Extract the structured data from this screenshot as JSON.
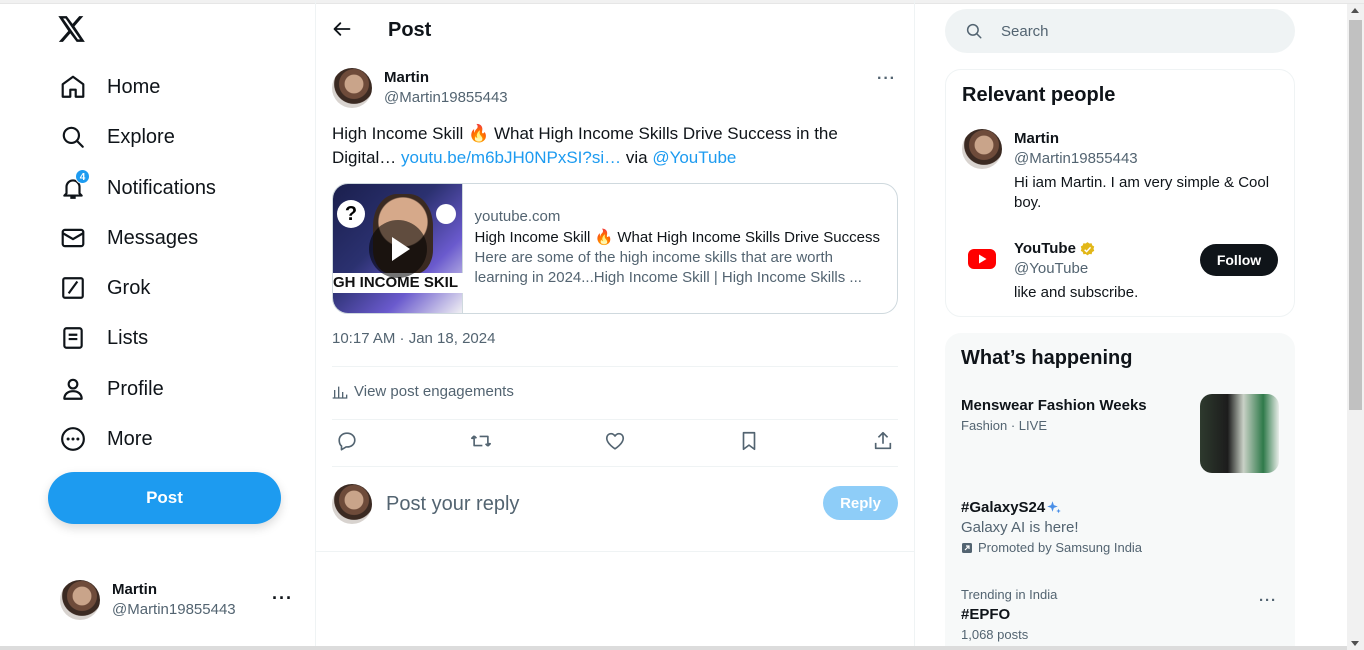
{
  "nav": {
    "items": [
      {
        "label": "Home",
        "icon": "home-icon"
      },
      {
        "label": "Explore",
        "icon": "search-icon"
      },
      {
        "label": "Notifications",
        "icon": "bell-icon",
        "badge": "4"
      },
      {
        "label": "Messages",
        "icon": "envelope-icon"
      },
      {
        "label": "Grok",
        "icon": "grok-icon"
      },
      {
        "label": "Lists",
        "icon": "list-icon"
      },
      {
        "label": "Profile",
        "icon": "person-icon"
      },
      {
        "label": "More",
        "icon": "more-circle-icon"
      }
    ],
    "post_label": "Post"
  },
  "account": {
    "name": "Martin",
    "handle": "@Martin19855443",
    "menu": "···"
  },
  "header": {
    "title": "Post"
  },
  "tweet": {
    "author_name": "Martin",
    "author_handle": "@Martin19855443",
    "menu": "···",
    "text_before": "High Income Skill 🔥 What High Income Skills Drive Success in the Digital… ",
    "link_text": "youtu.be/m6bJH0NPxSI?si…",
    "text_via": " via ",
    "mention": "@YouTube",
    "timestamp": "10:17 AM · Jan 18, 2024",
    "engagements": "View post engagements",
    "card": {
      "domain": "youtube.com",
      "title": "High Income Skill 🔥 What High Income Skills Drive Success",
      "description": "Here are some of the high income skills that are worth learning in 2024...High Income Skill | High Income Skills ...",
      "thumb_text": "GH INCOME SKIL",
      "thumb_q": "?"
    }
  },
  "reply": {
    "placeholder": "Post your reply",
    "button": "Reply"
  },
  "search": {
    "placeholder": "Search"
  },
  "relevant": {
    "title": "Relevant people",
    "people": [
      {
        "name": "Martin",
        "handle": "@Martin19855443",
        "bio": "Hi iam Martin. I am very simple & Cool boy."
      },
      {
        "name": "YouTube",
        "handle": "@YouTube",
        "bio": "like and subscribe.",
        "follow": "Follow"
      }
    ]
  },
  "happening": {
    "title": "What’s happening",
    "trends": [
      {
        "title": "Menswear Fashion Weeks",
        "context": "Fashion · LIVE"
      },
      {
        "title": "#GalaxyS24",
        "subtitle": "Galaxy AI is here!",
        "promo": "Promoted by Samsung India"
      },
      {
        "context": "Trending in India",
        "title": "#EPFO",
        "count": "1,068 posts",
        "menu": "···"
      }
    ]
  },
  "colors": {
    "accent": "#1d9bf0",
    "text": "#0f1419",
    "muted": "#536471",
    "reply_disabled": "#8ecdf8"
  }
}
